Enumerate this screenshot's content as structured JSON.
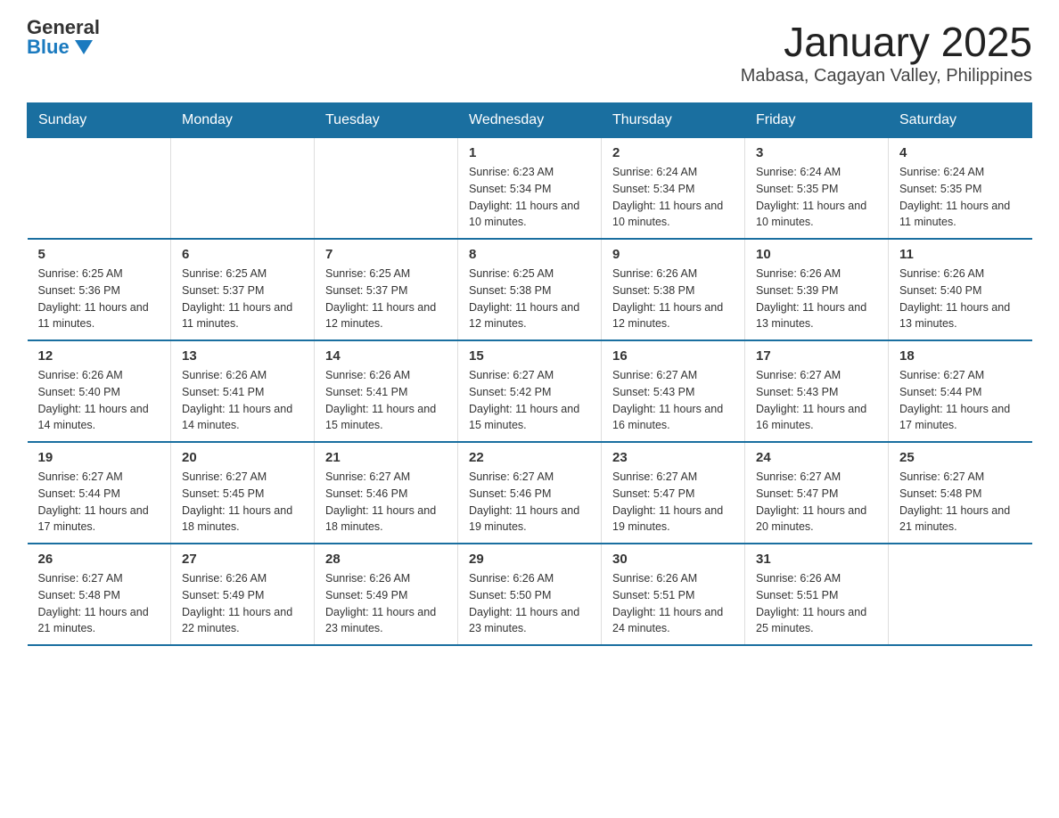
{
  "header": {
    "logo_general": "General",
    "logo_blue": "Blue",
    "title": "January 2025",
    "subtitle": "Mabasa, Cagayan Valley, Philippines"
  },
  "calendar": {
    "days_of_week": [
      "Sunday",
      "Monday",
      "Tuesday",
      "Wednesday",
      "Thursday",
      "Friday",
      "Saturday"
    ],
    "weeks": [
      [
        {
          "day": "",
          "info": ""
        },
        {
          "day": "",
          "info": ""
        },
        {
          "day": "",
          "info": ""
        },
        {
          "day": "1",
          "info": "Sunrise: 6:23 AM\nSunset: 5:34 PM\nDaylight: 11 hours and 10 minutes."
        },
        {
          "day": "2",
          "info": "Sunrise: 6:24 AM\nSunset: 5:34 PM\nDaylight: 11 hours and 10 minutes."
        },
        {
          "day": "3",
          "info": "Sunrise: 6:24 AM\nSunset: 5:35 PM\nDaylight: 11 hours and 10 minutes."
        },
        {
          "day": "4",
          "info": "Sunrise: 6:24 AM\nSunset: 5:35 PM\nDaylight: 11 hours and 11 minutes."
        }
      ],
      [
        {
          "day": "5",
          "info": "Sunrise: 6:25 AM\nSunset: 5:36 PM\nDaylight: 11 hours and 11 minutes."
        },
        {
          "day": "6",
          "info": "Sunrise: 6:25 AM\nSunset: 5:37 PM\nDaylight: 11 hours and 11 minutes."
        },
        {
          "day": "7",
          "info": "Sunrise: 6:25 AM\nSunset: 5:37 PM\nDaylight: 11 hours and 12 minutes."
        },
        {
          "day": "8",
          "info": "Sunrise: 6:25 AM\nSunset: 5:38 PM\nDaylight: 11 hours and 12 minutes."
        },
        {
          "day": "9",
          "info": "Sunrise: 6:26 AM\nSunset: 5:38 PM\nDaylight: 11 hours and 12 minutes."
        },
        {
          "day": "10",
          "info": "Sunrise: 6:26 AM\nSunset: 5:39 PM\nDaylight: 11 hours and 13 minutes."
        },
        {
          "day": "11",
          "info": "Sunrise: 6:26 AM\nSunset: 5:40 PM\nDaylight: 11 hours and 13 minutes."
        }
      ],
      [
        {
          "day": "12",
          "info": "Sunrise: 6:26 AM\nSunset: 5:40 PM\nDaylight: 11 hours and 14 minutes."
        },
        {
          "day": "13",
          "info": "Sunrise: 6:26 AM\nSunset: 5:41 PM\nDaylight: 11 hours and 14 minutes."
        },
        {
          "day": "14",
          "info": "Sunrise: 6:26 AM\nSunset: 5:41 PM\nDaylight: 11 hours and 15 minutes."
        },
        {
          "day": "15",
          "info": "Sunrise: 6:27 AM\nSunset: 5:42 PM\nDaylight: 11 hours and 15 minutes."
        },
        {
          "day": "16",
          "info": "Sunrise: 6:27 AM\nSunset: 5:43 PM\nDaylight: 11 hours and 16 minutes."
        },
        {
          "day": "17",
          "info": "Sunrise: 6:27 AM\nSunset: 5:43 PM\nDaylight: 11 hours and 16 minutes."
        },
        {
          "day": "18",
          "info": "Sunrise: 6:27 AM\nSunset: 5:44 PM\nDaylight: 11 hours and 17 minutes."
        }
      ],
      [
        {
          "day": "19",
          "info": "Sunrise: 6:27 AM\nSunset: 5:44 PM\nDaylight: 11 hours and 17 minutes."
        },
        {
          "day": "20",
          "info": "Sunrise: 6:27 AM\nSunset: 5:45 PM\nDaylight: 11 hours and 18 minutes."
        },
        {
          "day": "21",
          "info": "Sunrise: 6:27 AM\nSunset: 5:46 PM\nDaylight: 11 hours and 18 minutes."
        },
        {
          "day": "22",
          "info": "Sunrise: 6:27 AM\nSunset: 5:46 PM\nDaylight: 11 hours and 19 minutes."
        },
        {
          "day": "23",
          "info": "Sunrise: 6:27 AM\nSunset: 5:47 PM\nDaylight: 11 hours and 19 minutes."
        },
        {
          "day": "24",
          "info": "Sunrise: 6:27 AM\nSunset: 5:47 PM\nDaylight: 11 hours and 20 minutes."
        },
        {
          "day": "25",
          "info": "Sunrise: 6:27 AM\nSunset: 5:48 PM\nDaylight: 11 hours and 21 minutes."
        }
      ],
      [
        {
          "day": "26",
          "info": "Sunrise: 6:27 AM\nSunset: 5:48 PM\nDaylight: 11 hours and 21 minutes."
        },
        {
          "day": "27",
          "info": "Sunrise: 6:26 AM\nSunset: 5:49 PM\nDaylight: 11 hours and 22 minutes."
        },
        {
          "day": "28",
          "info": "Sunrise: 6:26 AM\nSunset: 5:49 PM\nDaylight: 11 hours and 23 minutes."
        },
        {
          "day": "29",
          "info": "Sunrise: 6:26 AM\nSunset: 5:50 PM\nDaylight: 11 hours and 23 minutes."
        },
        {
          "day": "30",
          "info": "Sunrise: 6:26 AM\nSunset: 5:51 PM\nDaylight: 11 hours and 24 minutes."
        },
        {
          "day": "31",
          "info": "Sunrise: 6:26 AM\nSunset: 5:51 PM\nDaylight: 11 hours and 25 minutes."
        },
        {
          "day": "",
          "info": ""
        }
      ]
    ]
  }
}
